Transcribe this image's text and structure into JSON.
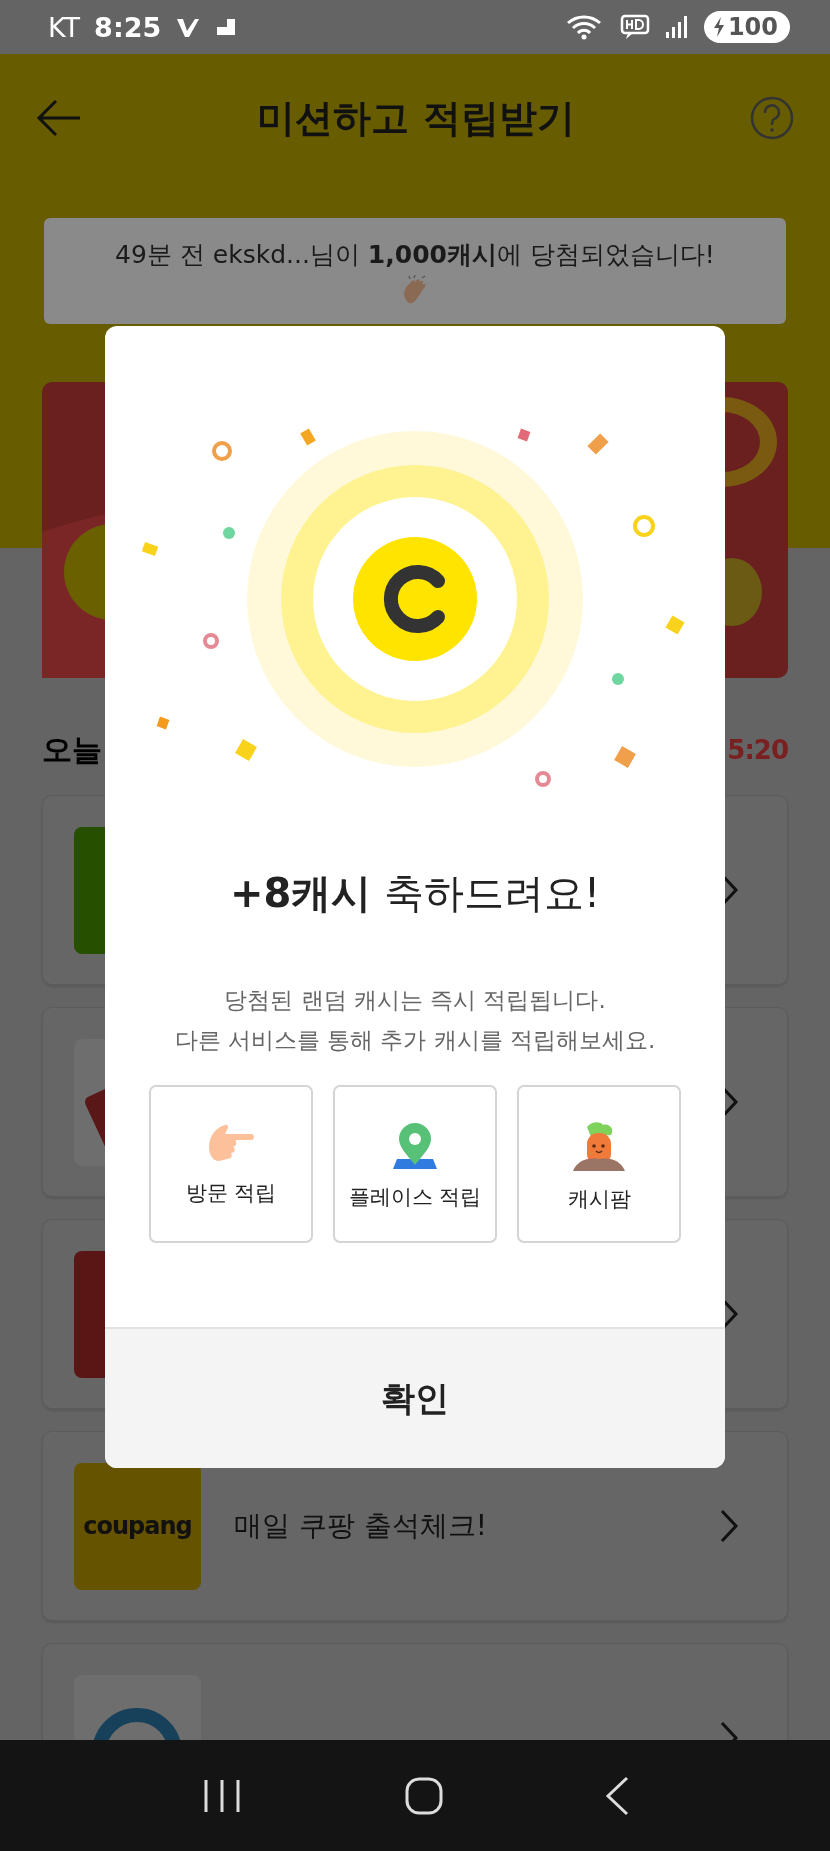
{
  "status_bar": {
    "carrier": "KT",
    "time": "8:25",
    "battery": "100"
  },
  "header": {
    "title": "미션하고 적립받기"
  },
  "ticker": {
    "text": "49분 전 ekskd...님이 **1,000캐시**에 당첨되었습니다!"
  },
  "section": {
    "title": "오늘",
    "timer": "5:20"
  },
  "missions": [
    {
      "kind": "tile",
      "color": "#265000"
    },
    {
      "kind": "tilted",
      "color": "#5a1717"
    },
    {
      "kind": "tile",
      "color": "#5a1515"
    },
    {
      "kind": "logo",
      "color": "#665300",
      "logo": "coupang",
      "title": "매일 쿠팡 출석체크!"
    },
    {
      "kind": "ring",
      "color": "#17405a"
    }
  ],
  "dialog": {
    "title": "**+8캐시** 축하드려요!",
    "message": [
      "당첨된 랜덤 캐시는 즉시 적립됩니다.",
      "다른 서비스를 통해 추가 캐시를 적립해보세요."
    ],
    "services": [
      {
        "kind": "hand",
        "label": "방문 적립"
      },
      {
        "kind": "pin",
        "label": "플레이스 적립"
      },
      {
        "kind": "carrot",
        "label": "캐시팜"
      }
    ],
    "confirm": "확인"
  }
}
